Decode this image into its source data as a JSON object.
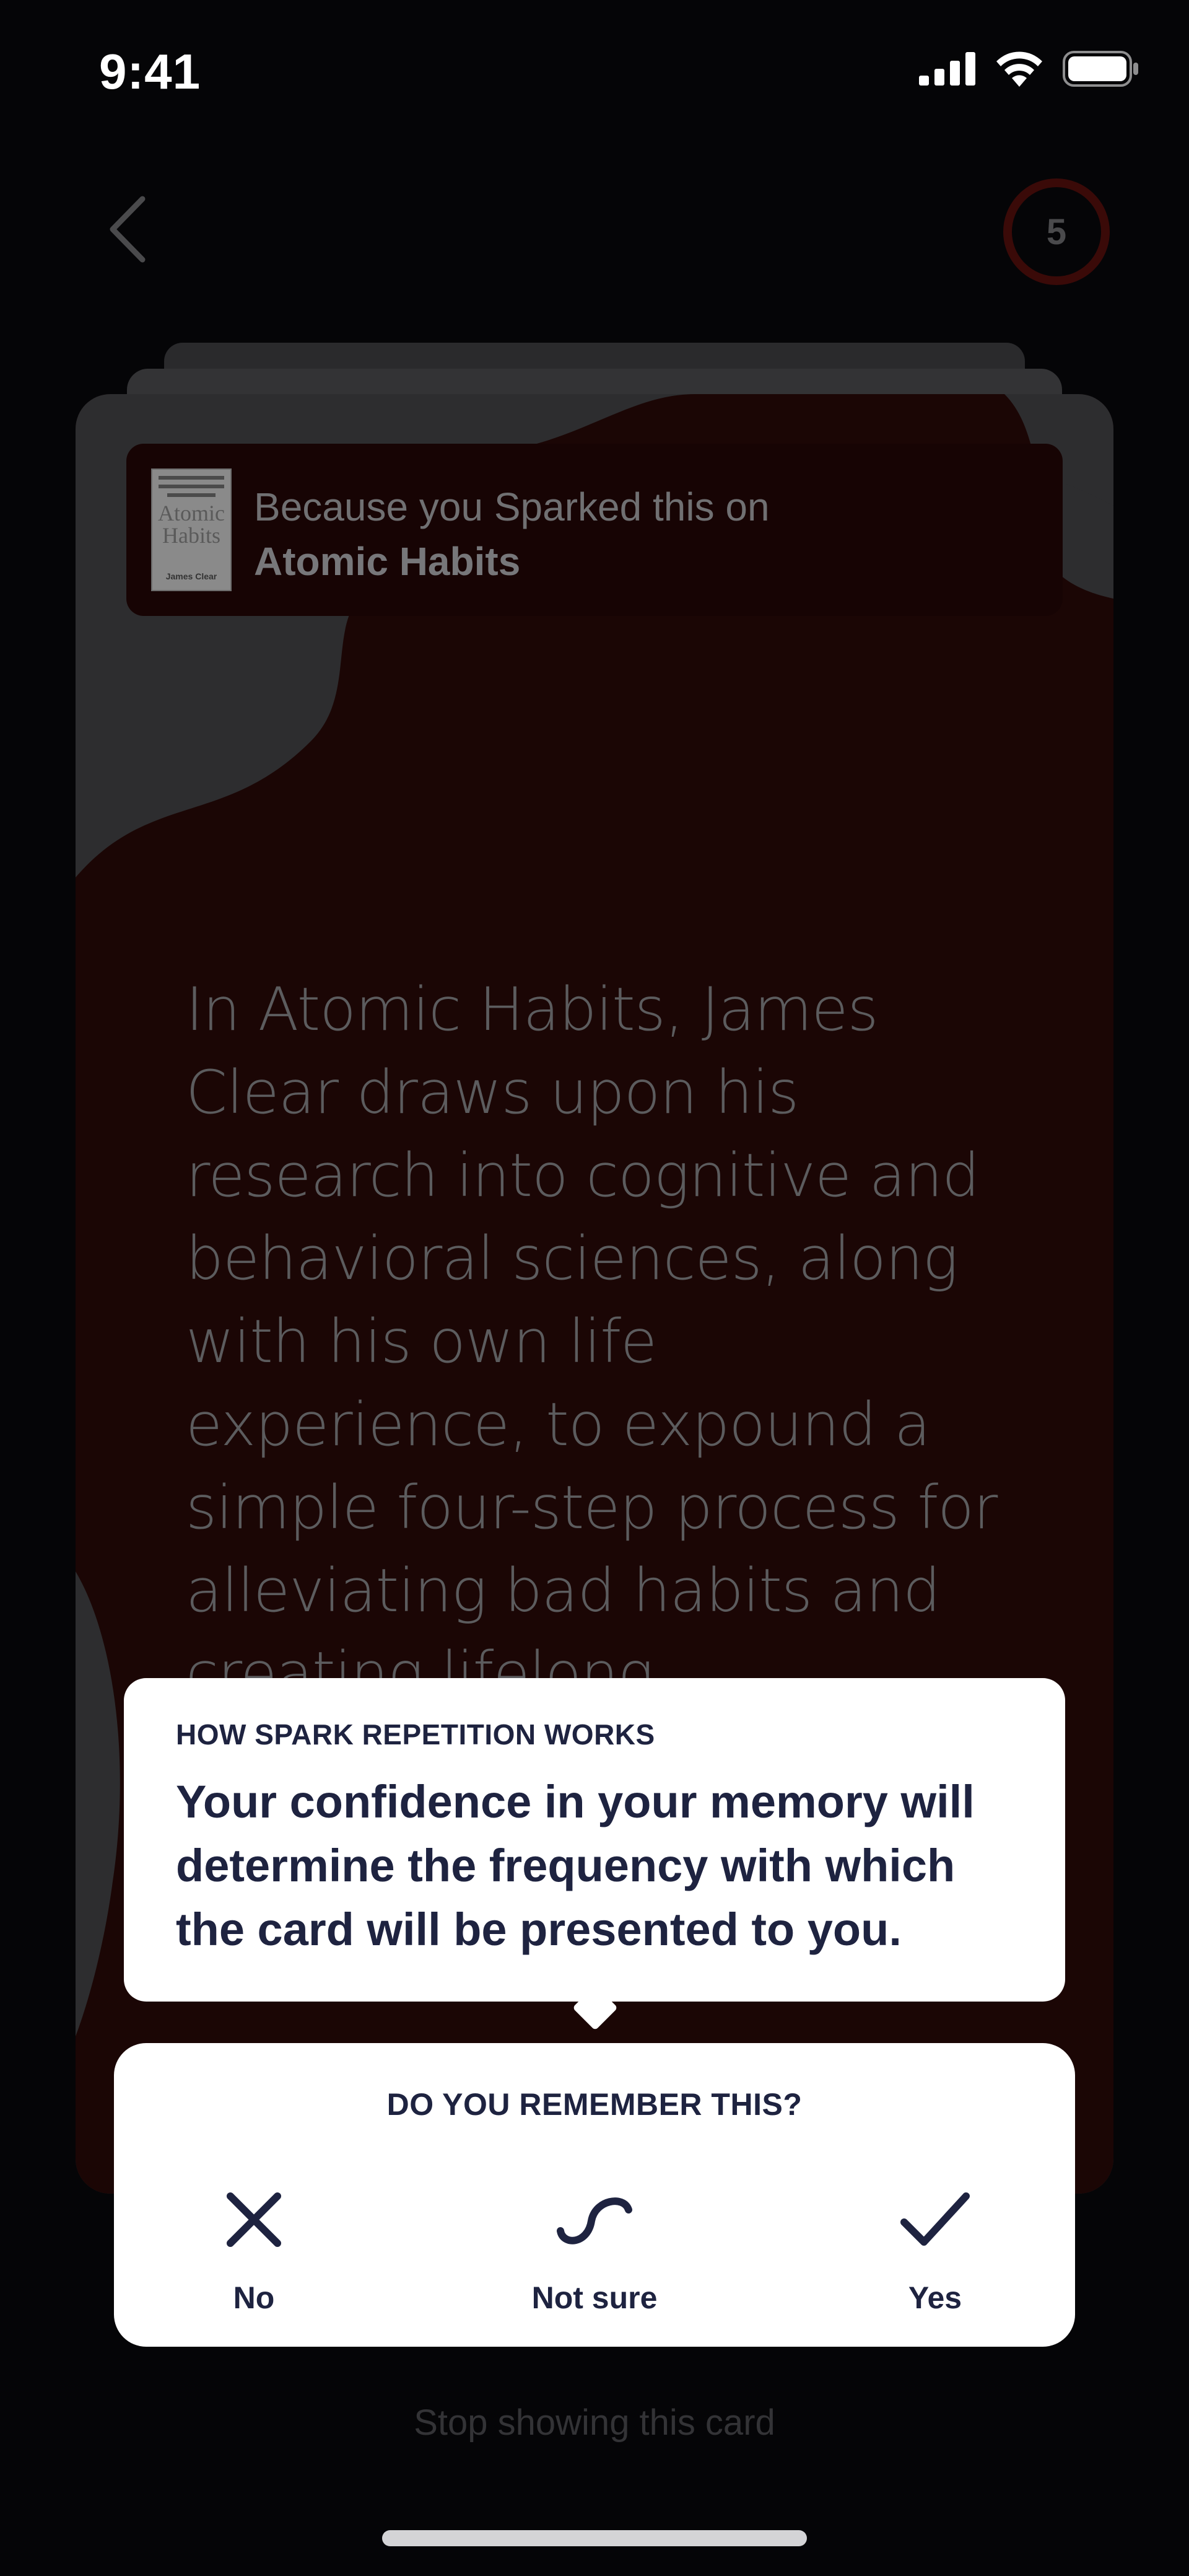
{
  "status_bar": {
    "time": "9:41",
    "icons": [
      "cellular-signal-icon",
      "wifi-icon",
      "battery-icon"
    ]
  },
  "nav": {
    "back_icon": "chevron-left-icon",
    "counter": "5"
  },
  "card": {
    "source_prefix": "Because you Sparked this on",
    "source_title": "Atomic Habits",
    "book_cover": {
      "title": "Atomic Habits",
      "author": "James Clear"
    },
    "body": "In Atomic Habits, James Clear draws upon his research into cognitive and behavioral sciences, along with his own life experience, to expound a simple four-step process for alleviating bad habits and creating lifelong"
  },
  "tooltip": {
    "heading": "HOW SPARK REPETITION WORKS",
    "text": "Your confidence in your memory will determine the frequency with which the card will be presented to you."
  },
  "answer_panel": {
    "question": "DO YOU REMEMBER THIS?",
    "options": [
      {
        "label": "No",
        "icon": "x-icon"
      },
      {
        "label": "Not sure",
        "icon": "wave-icon"
      },
      {
        "label": "Yes",
        "icon": "check-icon"
      }
    ]
  },
  "footer": {
    "stop_showing": "Stop showing this card"
  },
  "colors": {
    "background": "#050507",
    "card_background": "#1b0605",
    "panel_text": "#1e2340",
    "counter_ring": "#3a0a08"
  }
}
